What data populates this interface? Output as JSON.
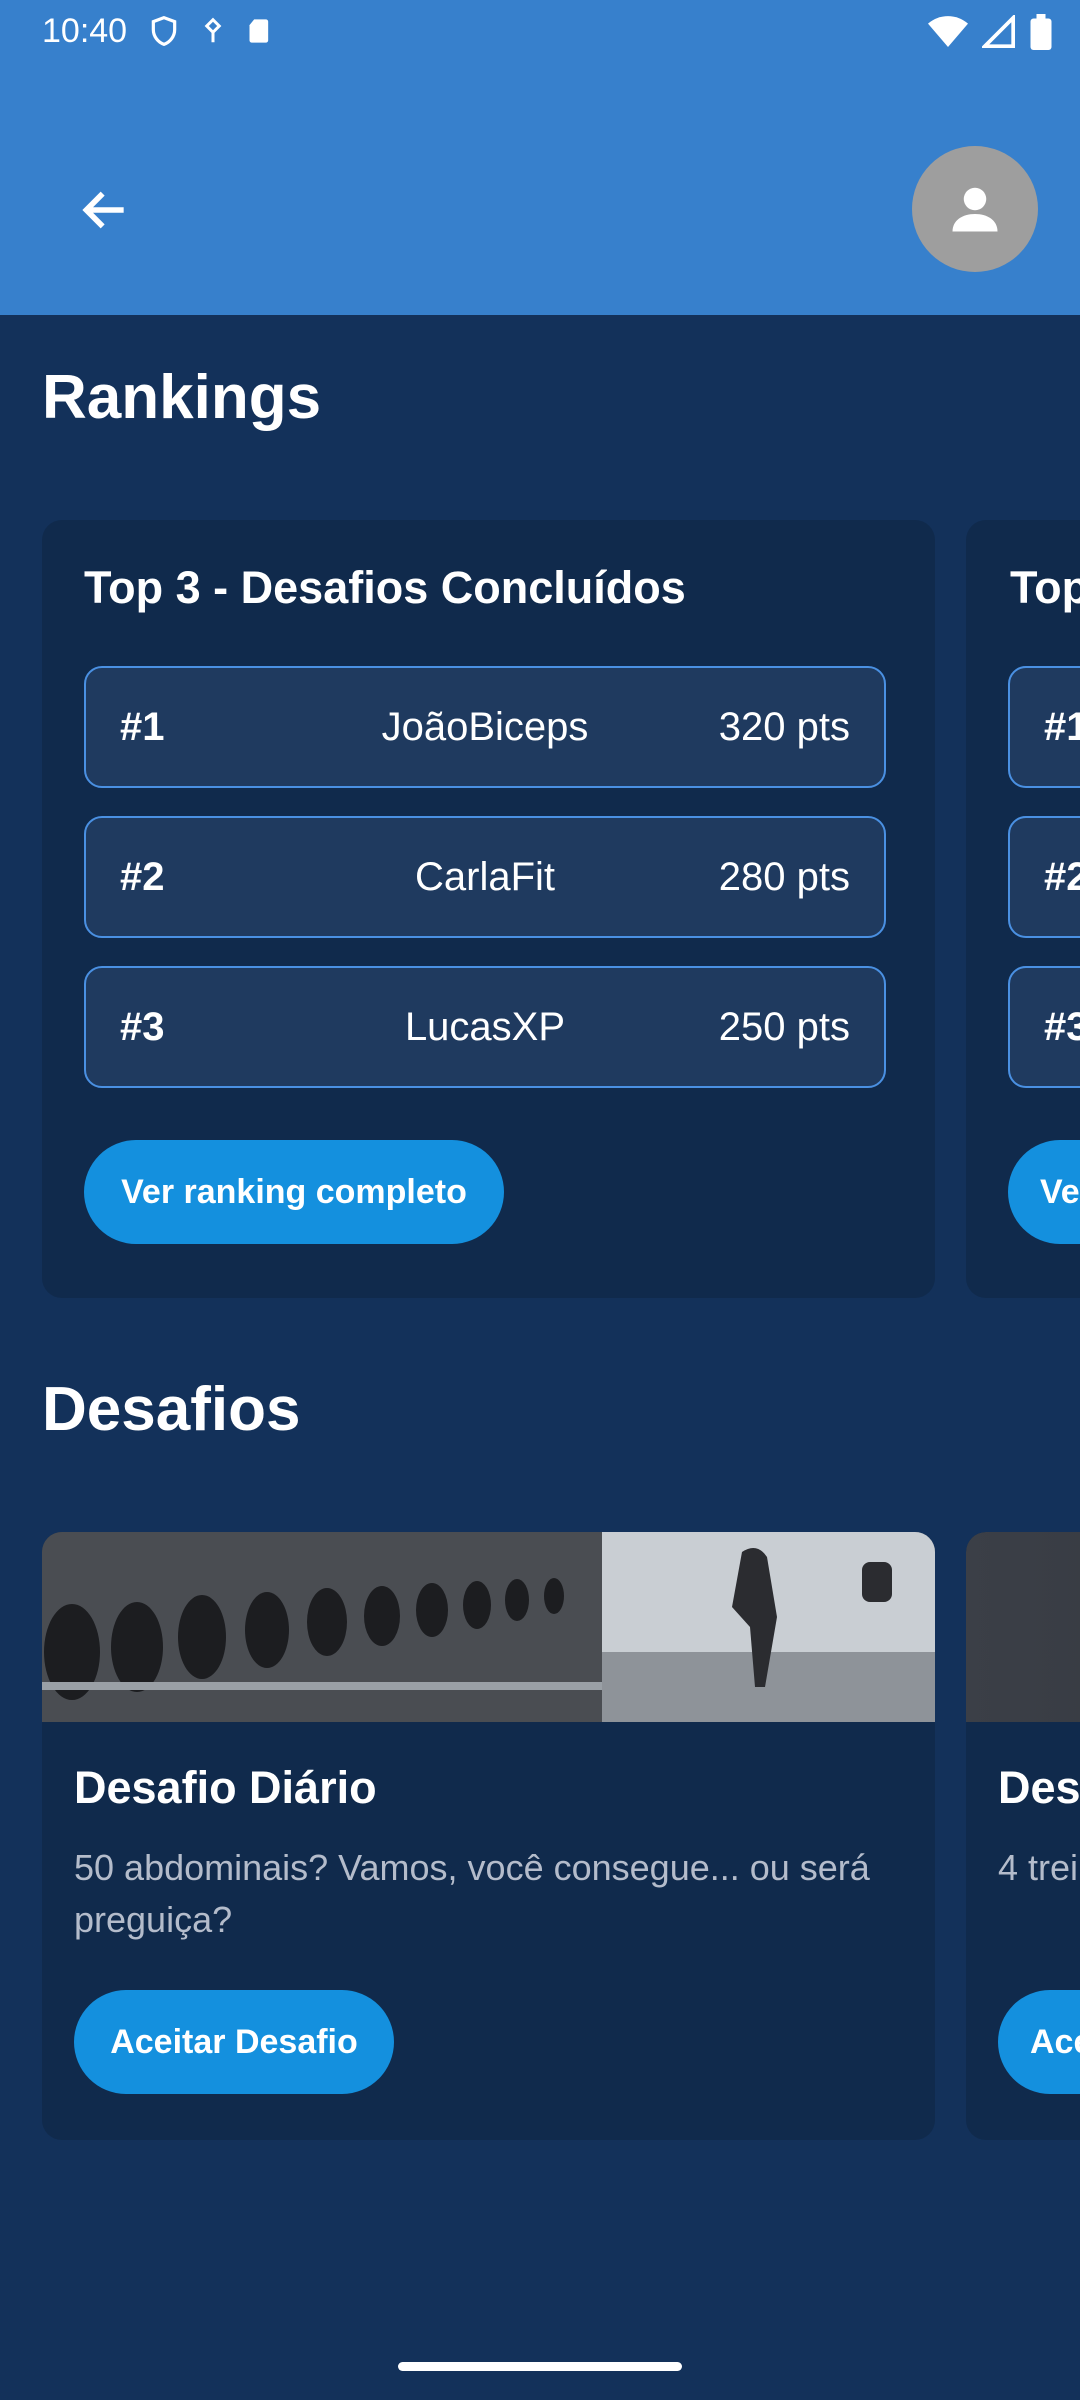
{
  "status_bar": {
    "time": "10:40"
  },
  "colors": {
    "app_bar": "#3780cc",
    "background": "#13315a",
    "card": "#102a4c",
    "accent": "#1490de",
    "row_border": "#4a90e2"
  },
  "header": {
    "back_icon": "arrow-left-icon",
    "profile_icon": "person-icon"
  },
  "rankings": {
    "title": "Rankings",
    "cards": [
      {
        "title": "Top 3 - Desafios Concluídos",
        "rows": [
          {
            "position": "#1",
            "name": "JoãoBiceps",
            "points": "320 pts"
          },
          {
            "position": "#2",
            "name": "CarlaFit",
            "points": "280 pts"
          },
          {
            "position": "#3",
            "name": "LucasXP",
            "points": "250 pts"
          }
        ],
        "button_label": "Ver ranking completo"
      },
      {
        "title": "Top",
        "rows": [
          {
            "position": "#1"
          },
          {
            "position": "#2"
          },
          {
            "position": "#3"
          }
        ],
        "button_label": "Ve"
      }
    ]
  },
  "challenges": {
    "title": "Desafios",
    "cards": [
      {
        "title": "Desafio Diário",
        "description": "50 abdominais? Vamos, você consegue... ou será preguiça?",
        "button_label": "Aceitar Desafio"
      },
      {
        "title": "Des",
        "description": "4 trei",
        "button_label": "Ace"
      }
    ]
  }
}
